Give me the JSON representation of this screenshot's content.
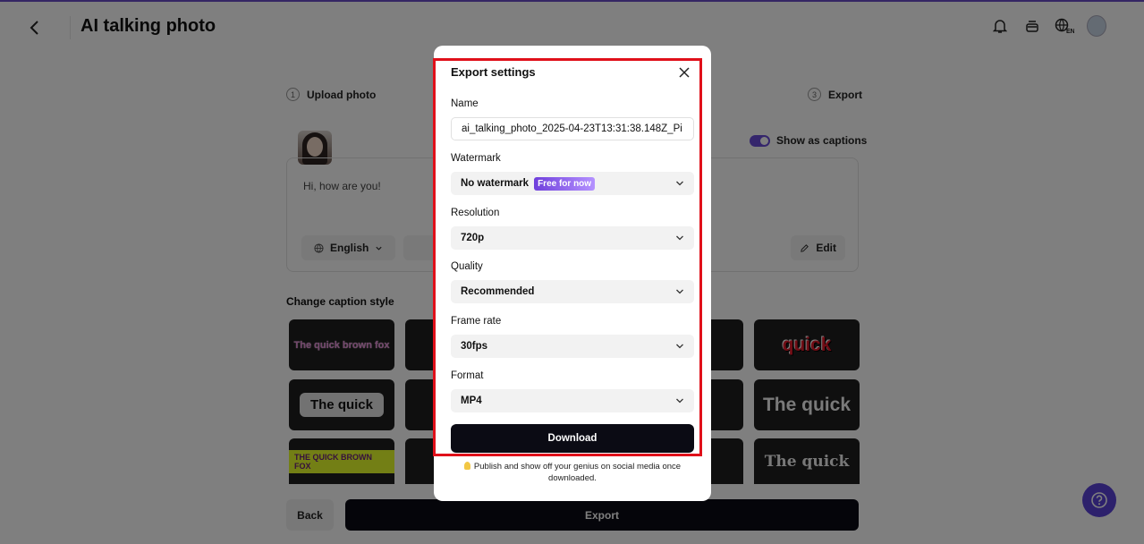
{
  "header": {
    "title": "AI talking photo"
  },
  "steps": [
    {
      "num": "1",
      "label": "Upload photo"
    },
    {
      "num": "3",
      "label": "Export"
    }
  ],
  "editor": {
    "show_captions_label": "Show as captions",
    "text": "Hi, how are you!",
    "language": "English",
    "edit_label": "Edit"
  },
  "caption_style": {
    "title": "Change caption style",
    "tiles": [
      "The quick brown fox",
      "quick",
      "The quick",
      "The quick",
      "THE QUICK BROWN FOX",
      "The quick"
    ]
  },
  "footer": {
    "back_label": "Back",
    "export_label": "Export"
  },
  "modal": {
    "title": "Export settings",
    "name_label": "Name",
    "name_value": "ai_talking_photo_2025-04-23T13:31:38.148Z_Pi",
    "watermark_label": "Watermark",
    "watermark_value": "No watermark",
    "watermark_badge": "Free for now",
    "resolution_label": "Resolution",
    "resolution_value": "720p",
    "quality_label": "Quality",
    "quality_value": "Recommended",
    "framerate_label": "Frame rate",
    "framerate_value": "30fps",
    "format_label": "Format",
    "format_value": "MP4",
    "download_label": "Download",
    "note": "Publish and show off your genius on social media once downloaded."
  },
  "colors": {
    "accent": "#6b4cd8",
    "highlight": "#e0101a",
    "primary_button": "#0b0b14"
  }
}
